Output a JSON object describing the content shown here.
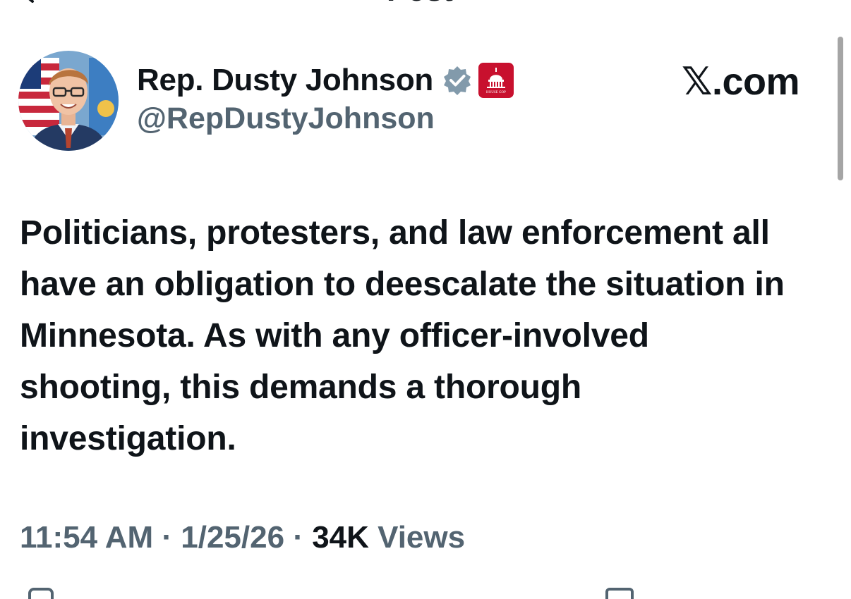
{
  "header": {
    "title": "Post"
  },
  "author": {
    "display_name": "Rep. Dusty Johnson",
    "handle": "@RepDustyJohnson",
    "affiliation_badge_text": "HOUSE GOP"
  },
  "source_logo": "𝕏.com",
  "post": {
    "text": "Politicians, protesters, and law enforcement all have an obligation to deescalate the situation in Minnesota. As with any officer-involved shooting, this demands a thorough investigation."
  },
  "meta": {
    "time": "11:54 AM",
    "separator": "·",
    "date": "1/25/26",
    "views_count": "34K",
    "views_label": "Views"
  },
  "colors": {
    "text_primary": "#0f1419",
    "text_secondary": "#536471",
    "verified": "#829aab",
    "affiliation": "#c8102e"
  },
  "icons": {
    "back": "arrow-left-icon",
    "verified": "verified-badge-icon",
    "affiliation": "capitol-dome-icon"
  }
}
